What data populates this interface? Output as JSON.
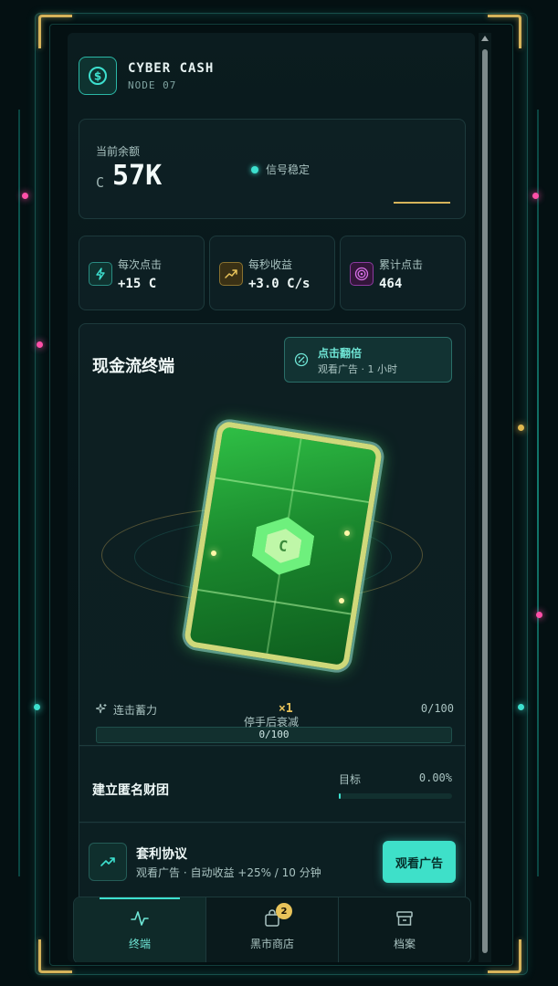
{
  "header": {
    "title": "CYBER CASH",
    "subtitle": "NODE 07"
  },
  "balance": {
    "label": "当前余额",
    "currency_symbol": "C",
    "amount": "57K",
    "status": "信号稳定"
  },
  "stats": [
    {
      "icon": "lightning-icon",
      "label": "每次点击",
      "value": "+15 C"
    },
    {
      "icon": "trend-up-icon",
      "label": "每秒收益",
      "value": "+3.0 C/s"
    },
    {
      "icon": "target-icon",
      "label": "累计点击",
      "value": "464"
    }
  ],
  "terminal": {
    "title": "现金流终端",
    "double_button": {
      "title": "点击翻倍",
      "subtitle": "观看广告 · 1 小时"
    },
    "card_symbol": "C",
    "combo": {
      "label": "连击蓄力",
      "multiplier": "×1",
      "count": "0/100",
      "bar_text": "0/100",
      "progress": 0
    },
    "decay_hint": "停手后衰减"
  },
  "syndicate": {
    "title": "建立匿名财团",
    "goal_label": "目标",
    "percent": "0.00%",
    "progress": 0.0
  },
  "arbitrage": {
    "title": "套利协议",
    "desc": "观看广告 · 自动收益 +25% / 10 分钟",
    "button": "观看广告"
  },
  "tabs": [
    {
      "icon": "pulse-icon",
      "label": "终端",
      "active": true
    },
    {
      "icon": "bag-icon",
      "label": "黑市商店",
      "badge": "2"
    },
    {
      "icon": "archive-icon",
      "label": "档案"
    }
  ],
  "colors": {
    "accent": "#3de0cf",
    "gold": "#d6b35a",
    "pink": "#ff4fa8",
    "background": "#041012"
  }
}
